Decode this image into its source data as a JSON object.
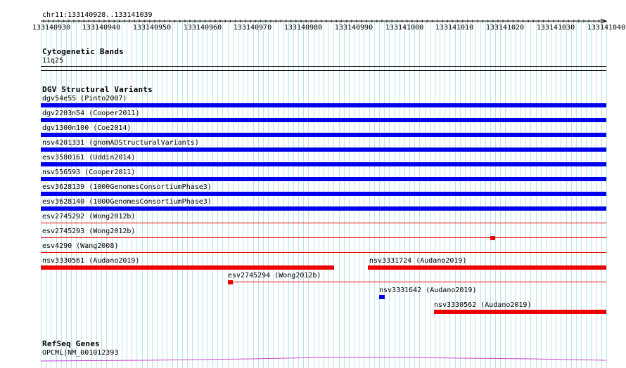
{
  "ruler": {
    "location": "chr11:133140928..133141039",
    "ticks": [
      "133140930",
      "133140940",
      "133140950",
      "133140960",
      "133140970",
      "133140980",
      "133140990",
      "133141000",
      "133141010",
      "133141020",
      "133141030",
      "133141040"
    ]
  },
  "cytoband": {
    "title": "Cytogenetic Bands",
    "band": "11q25"
  },
  "dgv": {
    "title": "DGV Structural Variants",
    "features": [
      {
        "label": "dgv54e55 (Pinto2007)",
        "color": "#0000ee",
        "style": "thick"
      },
      {
        "label": "dgv2203n54 (Cooper2011)",
        "color": "#0000ee",
        "style": "thick"
      },
      {
        "label": "dgv1300n100 (Coe2014)",
        "color": "#0000ee",
        "style": "thick"
      },
      {
        "label": "nsv4201331 (gnomADStructuralVariants)",
        "color": "#0000ee",
        "style": "thick"
      },
      {
        "label": "esv3580161 (Uddin2014)",
        "color": "#0000ee",
        "style": "thick"
      },
      {
        "label": "nsv556593 (Cooper2011)",
        "color": "#0000ee",
        "style": "thick"
      },
      {
        "label": "esv3628139 (1000GenomesConsortiumPhase3)",
        "color": "#0000ee",
        "style": "thick"
      },
      {
        "label": "esv3628140 (1000GenomesConsortiumPhase3)",
        "color": "#0000ee",
        "style": "thick"
      },
      {
        "label": "esv2745292 (Wong2012b)",
        "color": "#ee0000",
        "style": "thin"
      },
      {
        "label": "esv2745293 (Wong2012b)",
        "color": "#ee0000",
        "style": "thin-with-block"
      },
      {
        "label": "esv4290 (Wang2008)",
        "color": "#ee0000",
        "style": "thin"
      },
      {
        "label": "nsv3330561 (Audano2019)",
        "color": "#ee0000",
        "style": "thick"
      },
      {
        "label": "nsv3331724 (Audano2019)",
        "color": "#ee0000",
        "style": "thick"
      },
      {
        "label": "esv2745294 (Wong2012b)",
        "color": "#ee0000",
        "style": "thin-with-block"
      },
      {
        "label": "nsv3331642 (Audano2019)",
        "color": "#0000ee",
        "style": "block"
      },
      {
        "label": "nsv3330562 (Audano2019)",
        "color": "#ee0000",
        "style": "thick"
      }
    ]
  },
  "refseq": {
    "title": "RefSeq Genes",
    "gene": "OPCML|NM_001012393",
    "color": "#cc44cc"
  },
  "colors": {
    "grid": "#b8e6ee",
    "gain": "#0000ee",
    "loss": "#ee0000",
    "gene": "#cc44cc"
  }
}
